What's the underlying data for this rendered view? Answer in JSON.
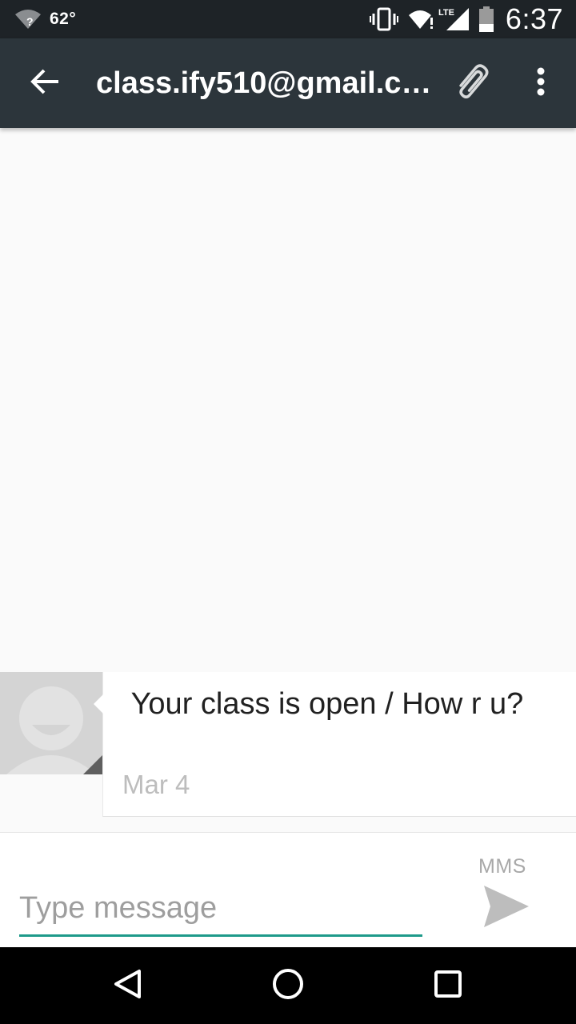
{
  "status_bar": {
    "temperature": "62°",
    "lte_label": "LTE",
    "time": "6:37"
  },
  "toolbar": {
    "title": "class.ify510@gmail.c…",
    "icons": {
      "back": "arrow-back-icon",
      "attach": "paperclip-icon",
      "more": "more-vert-icon"
    }
  },
  "messages": [
    {
      "text": " Your class is open / How r u?",
      "date": "Mar 4",
      "direction": "incoming"
    }
  ],
  "compose": {
    "placeholder": "Type message",
    "mms_label": "MMS",
    "send_icon": "send-icon"
  },
  "navbar": {
    "icons": [
      "back-triangle-icon",
      "home-circle-icon",
      "recents-square-icon"
    ]
  },
  "colors": {
    "status_bar_bg": "#1e2327",
    "toolbar_bg": "#2c353b",
    "accent": "#1e9a8a",
    "background": "#fafafa"
  }
}
